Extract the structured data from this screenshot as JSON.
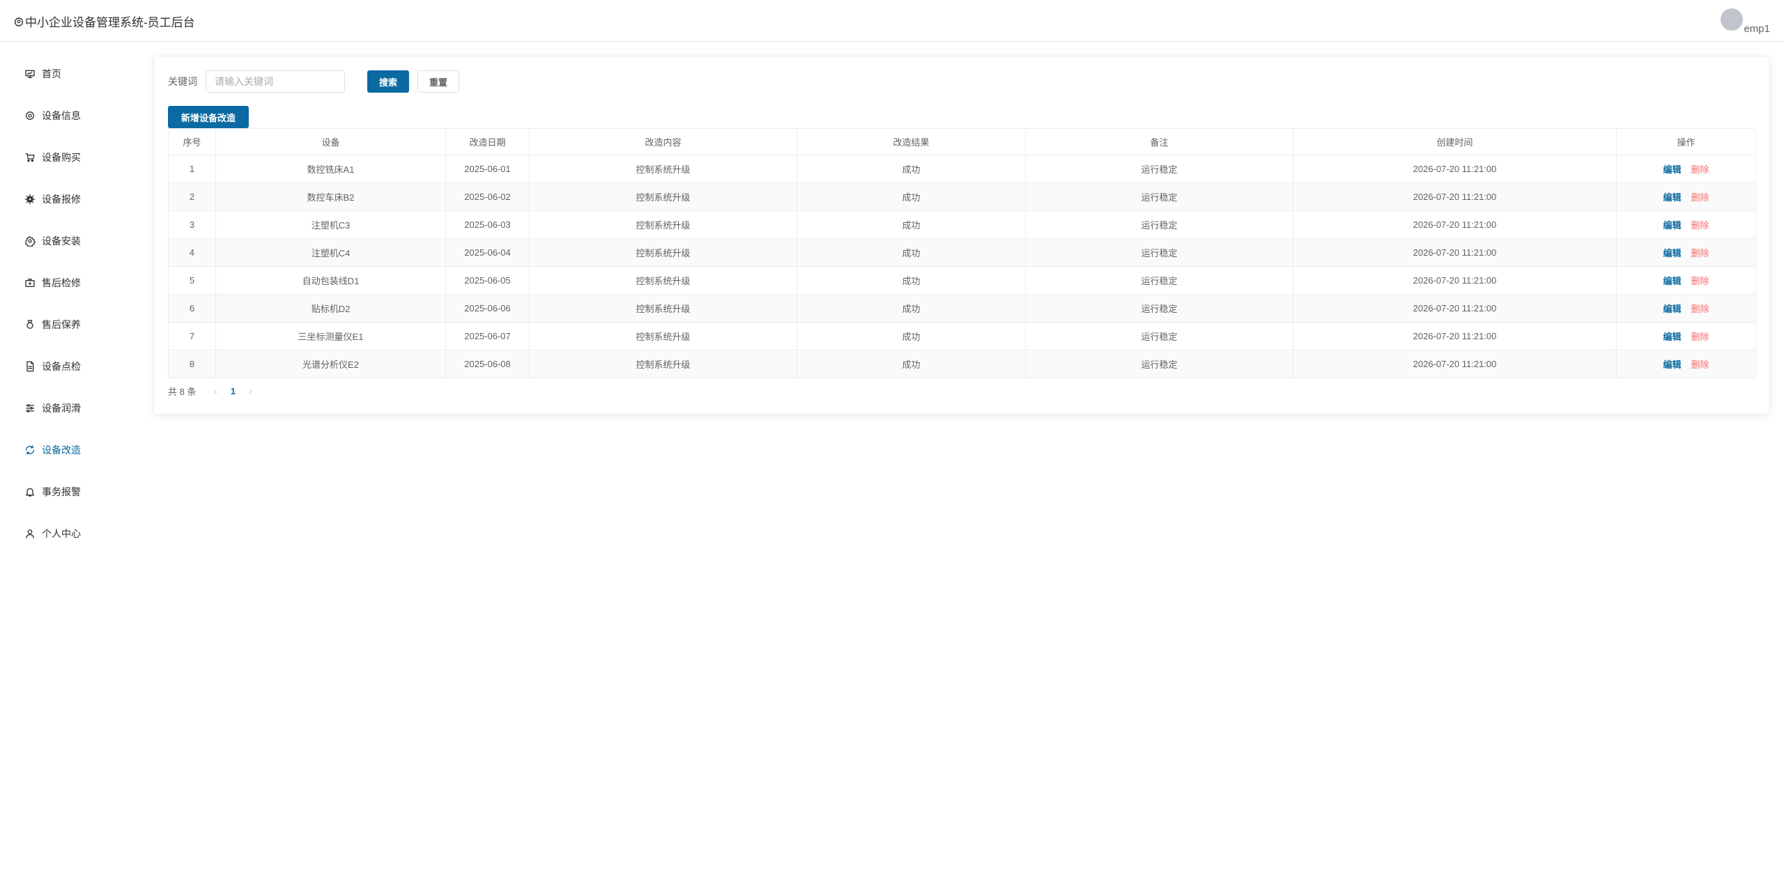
{
  "header": {
    "title": "中小企业设备管理系统-员工后台",
    "title_icon": "gear-icon",
    "username": "emp1"
  },
  "sidebar": {
    "items": [
      {
        "label": "首页",
        "icon": "home-icon"
      },
      {
        "label": "设备信息",
        "icon": "chip-icon"
      },
      {
        "label": "设备购买",
        "icon": "cart-icon"
      },
      {
        "label": "设备报修",
        "icon": "gear-filled-icon"
      },
      {
        "label": "设备安装",
        "icon": "gear-icon"
      },
      {
        "label": "售后检修",
        "icon": "toolbox-icon"
      },
      {
        "label": "售后保养",
        "icon": "medal-icon"
      },
      {
        "label": "设备点检",
        "icon": "document-icon"
      },
      {
        "label": "设备润滑",
        "icon": "sliders-icon"
      },
      {
        "label": "设备改造",
        "icon": "refresh-icon",
        "active": true
      },
      {
        "label": "事务报警",
        "icon": "bell-icon"
      },
      {
        "label": "个人中心",
        "icon": "user-icon"
      }
    ]
  },
  "search": {
    "label": "关键词",
    "placeholder": "请输入关键词",
    "value": "",
    "search_button": "搜索",
    "reset_button": "重置"
  },
  "add_button": "新增设备改造",
  "table": {
    "columns": [
      "序号",
      "设备",
      "改造日期",
      "改造内容",
      "改造结果",
      "备注",
      "创建时间",
      "操作"
    ],
    "edit_label": "编辑",
    "delete_label": "删除",
    "rows": [
      [
        "1",
        "数控铣床A1",
        "2025-06-01",
        "控制系统升级",
        "成功",
        "运行稳定",
        "2026-07-20 11:21:00"
      ],
      [
        "2",
        "数控车床B2",
        "2025-06-02",
        "控制系统升级",
        "成功",
        "运行稳定",
        "2026-07-20 11:21:00"
      ],
      [
        "3",
        "注塑机C3",
        "2025-06-03",
        "控制系统升级",
        "成功",
        "运行稳定",
        "2026-07-20 11:21:00"
      ],
      [
        "4",
        "注塑机C4",
        "2025-06-04",
        "控制系统升级",
        "成功",
        "运行稳定",
        "2026-07-20 11:21:00"
      ],
      [
        "5",
        "自动包装线D1",
        "2025-06-05",
        "控制系统升级",
        "成功",
        "运行稳定",
        "2026-07-20 11:21:00"
      ],
      [
        "6",
        "贴标机D2",
        "2025-06-06",
        "控制系统升级",
        "成功",
        "运行稳定",
        "2026-07-20 11:21:00"
      ],
      [
        "7",
        "三坐标测量仪E1",
        "2025-06-07",
        "控制系统升级",
        "成功",
        "运行稳定",
        "2026-07-20 11:21:00"
      ],
      [
        "8",
        "光谱分析仪E2",
        "2025-06-08",
        "控制系统升级",
        "成功",
        "运行稳定",
        "2026-07-20 11:21:00"
      ]
    ]
  },
  "pagination": {
    "total_text": "共 8 条",
    "current_page": "1"
  },
  "colors": {
    "primary": "#0b6aa2",
    "danger": "#f56c6c"
  }
}
